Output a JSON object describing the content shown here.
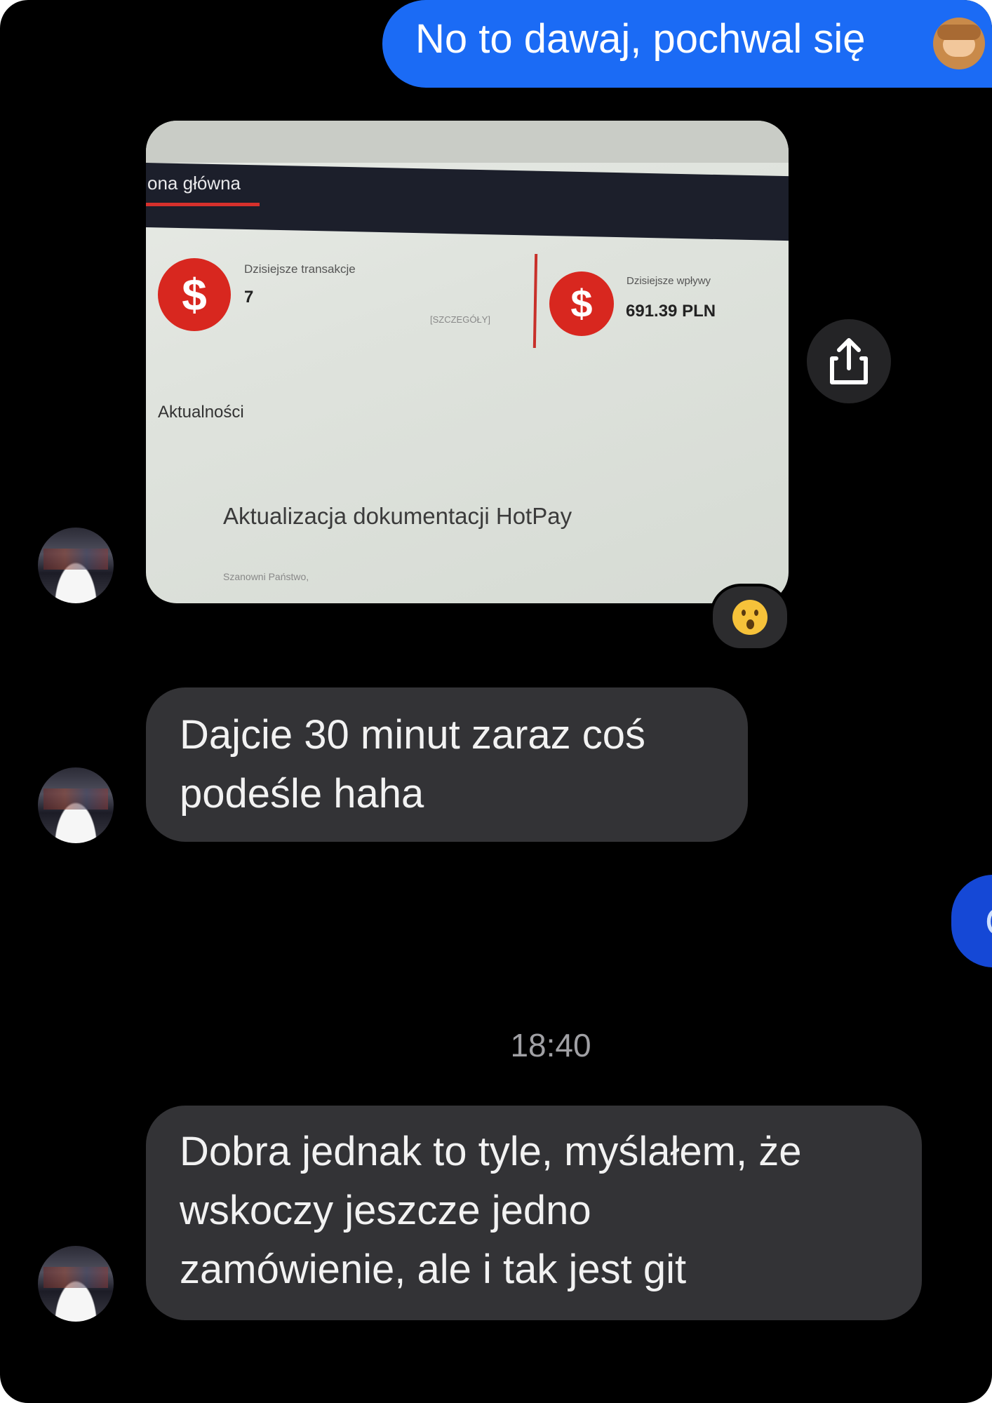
{
  "outgoing": {
    "text": "No to dawaj, pochwal się",
    "emoji": "see-no-evil-monkey"
  },
  "photo": {
    "nav_label": "ona główna",
    "card1": {
      "label": "Dzisiejsze transakcje",
      "value": "7",
      "link": "[SZCZEGÓŁY]"
    },
    "card2": {
      "label": "Dzisiejsze wpływy",
      "value": "691.39 PLN"
    },
    "dollar_symbol": "$",
    "news_label": "Aktualności",
    "headline": "Aktualizacja dokumentacji HotPay",
    "footer": "Szanowni Państwo,"
  },
  "reaction": {
    "emoji": "surprised-face"
  },
  "messages": {
    "msg1": {
      "line1": "Dajcie 30 minut zaraz coś",
      "line2": "podeśle haha"
    },
    "msg2": {
      "line1": "Dobra jednak to tyle, myślałem, że",
      "line2": "wskoczy jeszcze jedno",
      "line3": "zamówienie, ale i tak jest git"
    }
  },
  "partial_outgoing": {
    "text": "C"
  },
  "timestamp": "18:40",
  "colors": {
    "background": "#000000",
    "outgoing_bubble": "#1b6bf5",
    "incoming_bubble": "#333336",
    "accent_red": "#d8271f"
  }
}
